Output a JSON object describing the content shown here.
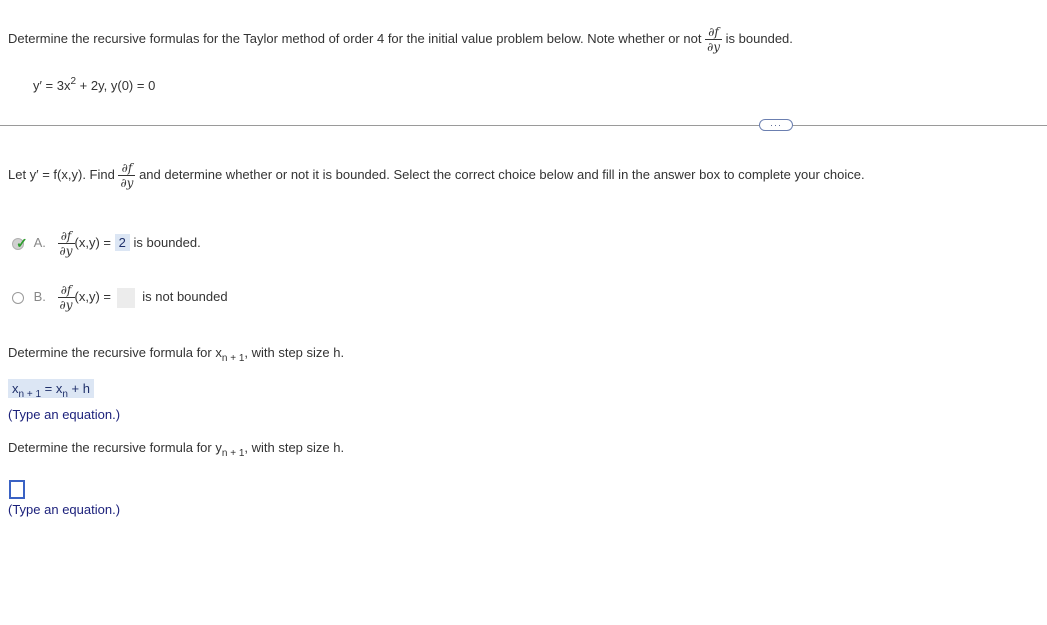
{
  "question": {
    "intro": "Determine the recursive formulas for the Taylor method of order 4 for the initial value problem below. Note whether or not",
    "intro_tail": "is bounded.",
    "partial_num": "∂f",
    "partial_den": "∂y",
    "ivp_lhs": "y′ = 3x",
    "ivp_exp": "2",
    "ivp_rhs": "+ 2y, y(0) = 0"
  },
  "more_button": "···",
  "part1": {
    "prompt_a": "Let y′ = f(x,y). Find",
    "prompt_b": "and determine whether or not it is bounded. Select the correct choice below and fill in the answer box to complete your choice."
  },
  "choices": [
    {
      "label": "A.",
      "xy": "(x,y) =",
      "answer": "2",
      "tail": "is bounded.",
      "selected": true
    },
    {
      "label": "B.",
      "xy": "(x,y) =",
      "answer": "",
      "tail": "is not bounded",
      "selected": false
    }
  ],
  "part2": {
    "prompt": "Determine the recursive formula for x",
    "prompt_sub": "n + 1",
    "prompt_tail": ", with step size h.",
    "eq_lhs": "x",
    "eq_lhs_sub": "n + 1",
    "eq_mid": " = x",
    "eq_mid_sub": "n",
    "eq_tail": " + h",
    "hint": "(Type an equation.)"
  },
  "part3": {
    "prompt": "Determine the recursive formula for y",
    "prompt_sub": "n + 1",
    "prompt_tail": ", with step size h.",
    "hint": "(Type an equation.)"
  },
  "colors": {
    "accent": "#3a62c4",
    "check": "#2e9e2e",
    "filled": "#dce6f4"
  }
}
